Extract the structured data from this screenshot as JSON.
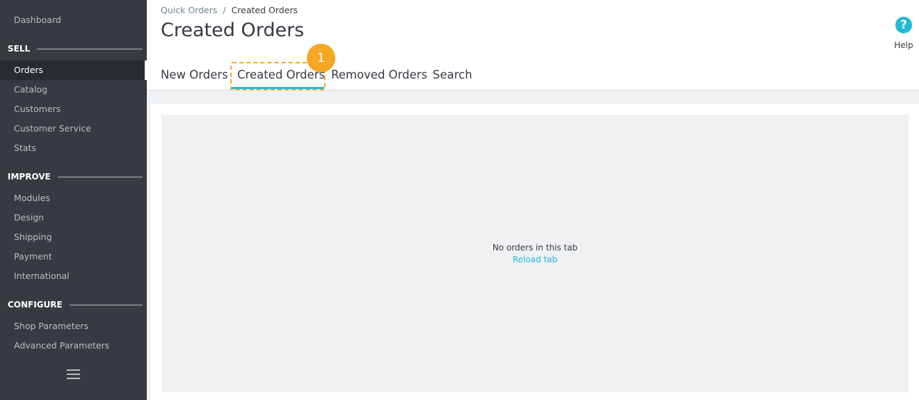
{
  "sidebar": {
    "dashboard": "Dashboard",
    "sections": [
      {
        "title": "SELL",
        "items": [
          "Orders",
          "Catalog",
          "Customers",
          "Customer Service",
          "Stats"
        ]
      },
      {
        "title": "IMPROVE",
        "items": [
          "Modules",
          "Design",
          "Shipping",
          "Payment",
          "International"
        ]
      },
      {
        "title": "CONFIGURE",
        "items": [
          "Shop Parameters",
          "Advanced Parameters"
        ]
      }
    ],
    "active_item": "Orders",
    "menu_icon": "hamburger-icon"
  },
  "breadcrumb": {
    "parent": "Quick Orders",
    "separator": "/",
    "current": "Created Orders"
  },
  "page_title": "Created Orders",
  "help": {
    "label": "Help",
    "icon": "question-circle-icon",
    "glyph": "?"
  },
  "tabs": [
    {
      "label": "New Orders"
    },
    {
      "label": "Created Orders",
      "active": true
    },
    {
      "label": "Removed Orders"
    },
    {
      "label": "Search"
    }
  ],
  "annotation": {
    "step": "1"
  },
  "content": {
    "empty_message": "No orders in this tab",
    "reload_link": "Reload tab"
  },
  "colors": {
    "accent": "#25b9d7",
    "sidebar_bg": "#363a41",
    "annotation": "#f5a623"
  }
}
